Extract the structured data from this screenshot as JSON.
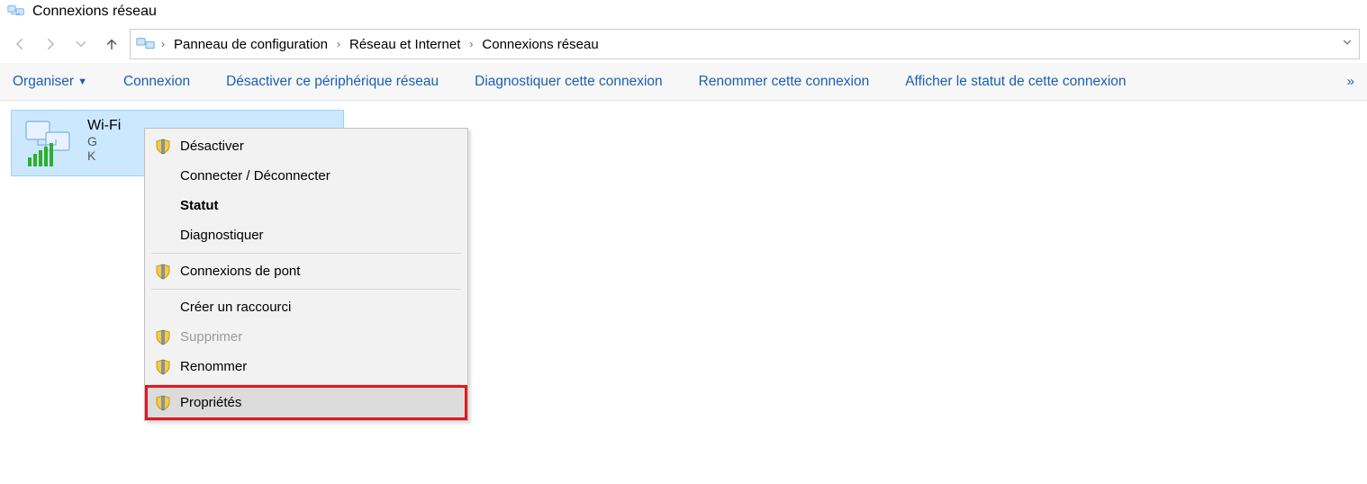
{
  "window": {
    "title": "Connexions réseau"
  },
  "breadcrumb": {
    "items": [
      "Panneau de configuration",
      "Réseau et Internet",
      "Connexions réseau"
    ]
  },
  "commands": {
    "organize": "Organiser",
    "connection": "Connexion",
    "disable": "Désactiver ce périphérique réseau",
    "diagnose": "Diagnostiquer cette connexion",
    "rename": "Renommer cette connexion",
    "status": "Afficher le statut de cette connexion",
    "overflow": "»"
  },
  "adapter": {
    "name": "Wi-Fi",
    "line2": "G",
    "line3": "K"
  },
  "context_menu": {
    "disable": "Désactiver",
    "connect": "Connecter / Déconnecter",
    "status": "Statut",
    "diagnose": "Diagnostiquer",
    "bridge": "Connexions de pont",
    "shortcut": "Créer un raccourci",
    "delete": "Supprimer",
    "rename": "Renommer",
    "properties": "Propriétés"
  }
}
